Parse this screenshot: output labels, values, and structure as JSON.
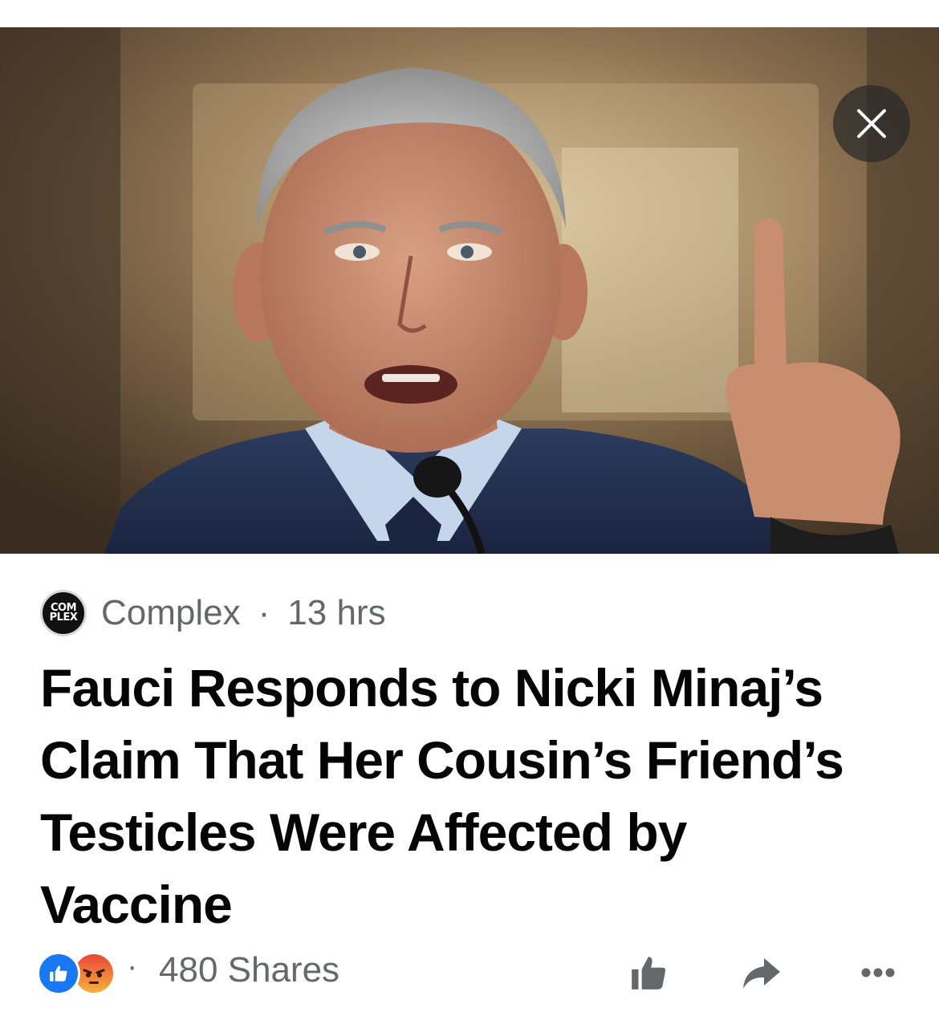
{
  "post": {
    "source_logo_line1": "COM",
    "source_logo_line2": "PLEX",
    "source_name": "Complex",
    "separator": "·",
    "time": "13 hrs",
    "headline": "Fauci Responds to Nicki Minaj’s Claim That Her Cousin’s Friend’s Testicles Were Affected by Vaccine",
    "shares": "480 Shares"
  },
  "icons": {
    "close": "close-icon",
    "like_reaction": "like-reaction-icon",
    "angry_reaction": "angry-reaction-icon",
    "like_action": "thumbs-up-icon",
    "share_action": "share-arrow-icon",
    "more_action": "more-options-icon"
  },
  "colors": {
    "like_blue": "#1877f2",
    "angry_orange": "#f7a33b",
    "secondary_text": "#65676b",
    "headline_text": "#050505"
  }
}
